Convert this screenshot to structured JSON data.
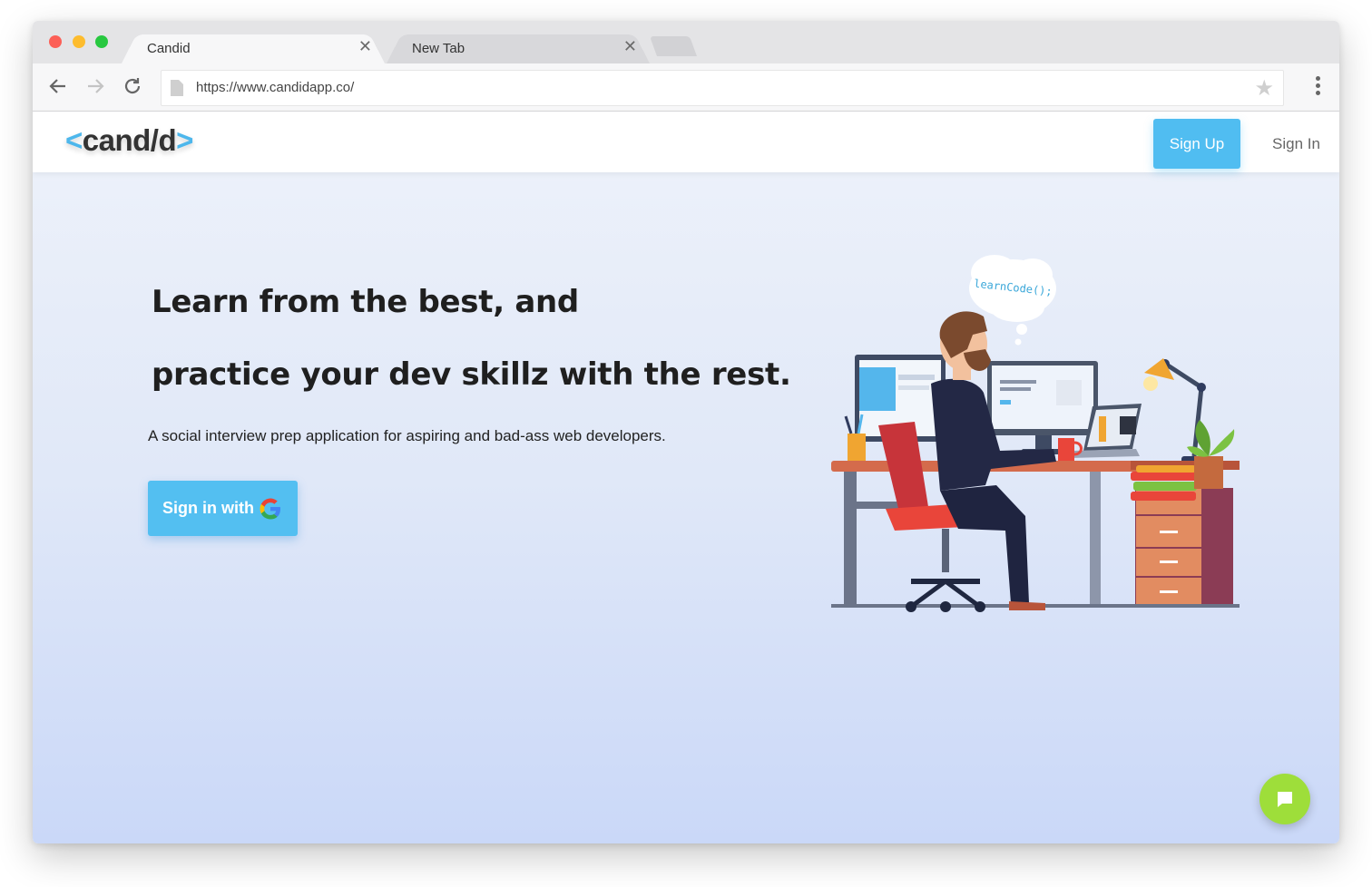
{
  "browser": {
    "tabs": [
      {
        "title": "Candid",
        "active": true
      },
      {
        "title": "New Tab",
        "active": false
      }
    ],
    "url": "https://www.candidapp.co/",
    "icons": {
      "back": "arrow-left-icon",
      "forward": "arrow-right-icon",
      "reload": "reload-icon",
      "star": "star-icon",
      "menu": "kebab-menu-icon",
      "page": "page-icon"
    },
    "colors": {
      "close": "#fc5f57",
      "minimize": "#fdbc2e",
      "maximize": "#28c840"
    }
  },
  "site": {
    "logo": {
      "left": "<",
      "text": "cand/d",
      "right": ">"
    },
    "nav": {
      "signup": "Sign Up",
      "signin": "Sign In"
    },
    "hero": {
      "headline_line1": "Learn from the best, and",
      "headline_line2": "practice your dev skillz with the rest.",
      "tagline": "A social interview prep application for aspiring and bad-ass web developers.",
      "cta": "Sign in with"
    },
    "illustration": {
      "thought_bubble": "learnCode();"
    },
    "colors": {
      "accent": "#50bdf1",
      "chat": "#9ede3a"
    }
  }
}
